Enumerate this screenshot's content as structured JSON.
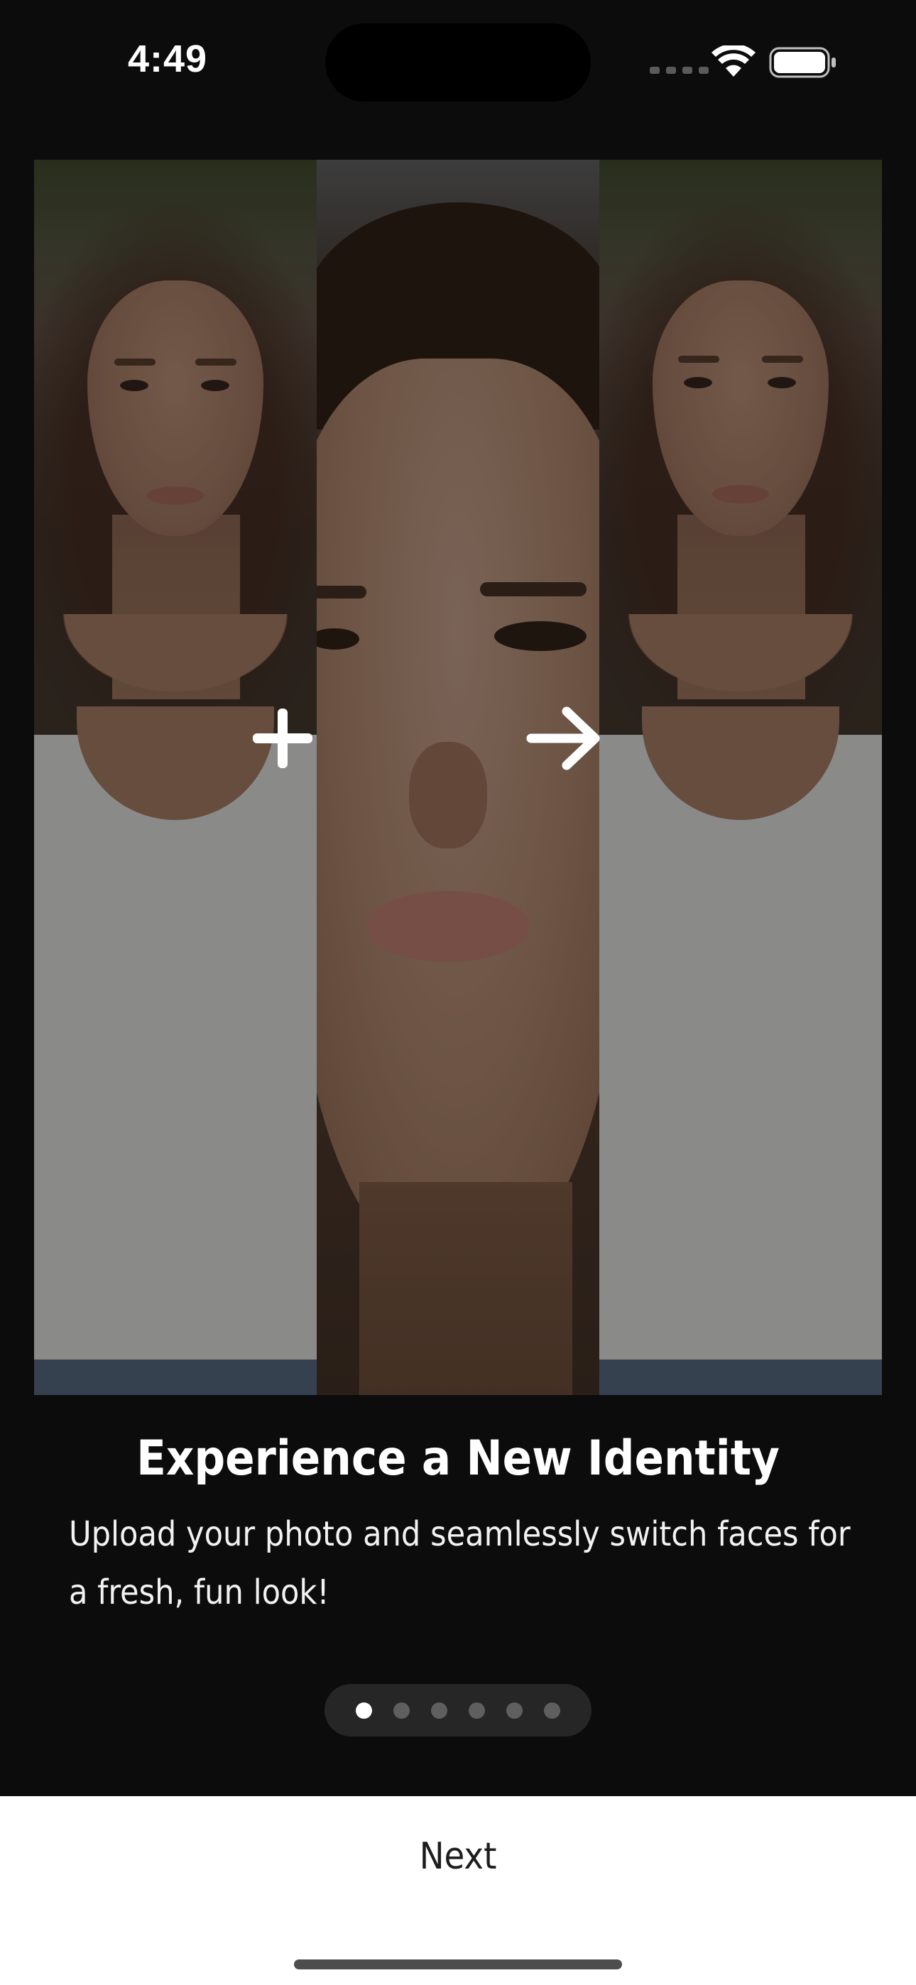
{
  "status_bar": {
    "time": "4:49"
  },
  "onboarding": {
    "title": "Experience a New Identity",
    "subtitle": "Upload your photo and seamlessly switch faces for a fresh, fun look!"
  },
  "pager": {
    "total_pages": 6,
    "current_page": 1
  },
  "actions": {
    "next_label": "Next"
  },
  "colors": {
    "background": "#0c0c0c",
    "bottom_bar": "#ffffff",
    "indicator_pill": "#262626",
    "dot_active": "#ffffff",
    "dot_inactive": "#5f5f5f"
  },
  "icons": {
    "combine": "plus-icon",
    "result": "arrow-right-icon"
  }
}
